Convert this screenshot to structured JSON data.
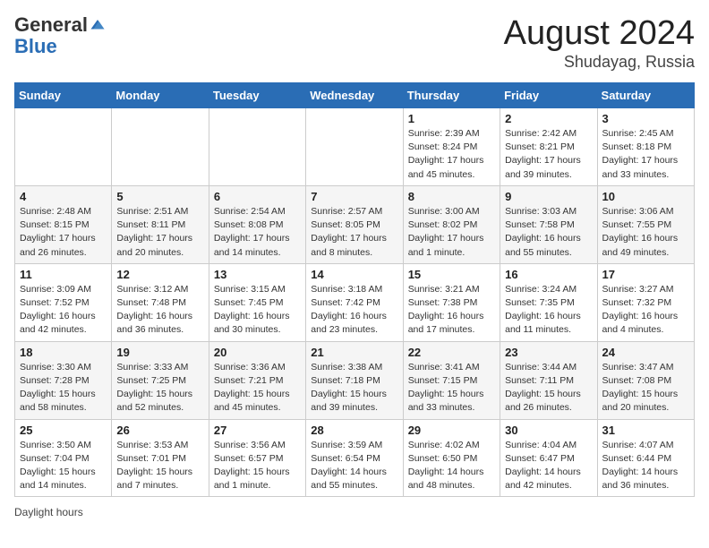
{
  "header": {
    "logo_general": "General",
    "logo_blue": "Blue",
    "title": "August 2024",
    "location": "Shudayag, Russia"
  },
  "weekdays": [
    "Sunday",
    "Monday",
    "Tuesday",
    "Wednesday",
    "Thursday",
    "Friday",
    "Saturday"
  ],
  "weeks": [
    [
      {
        "day": "",
        "info": ""
      },
      {
        "day": "",
        "info": ""
      },
      {
        "day": "",
        "info": ""
      },
      {
        "day": "",
        "info": ""
      },
      {
        "day": "1",
        "info": "Sunrise: 2:39 AM\nSunset: 8:24 PM\nDaylight: 17 hours and 45 minutes."
      },
      {
        "day": "2",
        "info": "Sunrise: 2:42 AM\nSunset: 8:21 PM\nDaylight: 17 hours and 39 minutes."
      },
      {
        "day": "3",
        "info": "Sunrise: 2:45 AM\nSunset: 8:18 PM\nDaylight: 17 hours and 33 minutes."
      }
    ],
    [
      {
        "day": "4",
        "info": "Sunrise: 2:48 AM\nSunset: 8:15 PM\nDaylight: 17 hours and 26 minutes."
      },
      {
        "day": "5",
        "info": "Sunrise: 2:51 AM\nSunset: 8:11 PM\nDaylight: 17 hours and 20 minutes."
      },
      {
        "day": "6",
        "info": "Sunrise: 2:54 AM\nSunset: 8:08 PM\nDaylight: 17 hours and 14 minutes."
      },
      {
        "day": "7",
        "info": "Sunrise: 2:57 AM\nSunset: 8:05 PM\nDaylight: 17 hours and 8 minutes."
      },
      {
        "day": "8",
        "info": "Sunrise: 3:00 AM\nSunset: 8:02 PM\nDaylight: 17 hours and 1 minute."
      },
      {
        "day": "9",
        "info": "Sunrise: 3:03 AM\nSunset: 7:58 PM\nDaylight: 16 hours and 55 minutes."
      },
      {
        "day": "10",
        "info": "Sunrise: 3:06 AM\nSunset: 7:55 PM\nDaylight: 16 hours and 49 minutes."
      }
    ],
    [
      {
        "day": "11",
        "info": "Sunrise: 3:09 AM\nSunset: 7:52 PM\nDaylight: 16 hours and 42 minutes."
      },
      {
        "day": "12",
        "info": "Sunrise: 3:12 AM\nSunset: 7:48 PM\nDaylight: 16 hours and 36 minutes."
      },
      {
        "day": "13",
        "info": "Sunrise: 3:15 AM\nSunset: 7:45 PM\nDaylight: 16 hours and 30 minutes."
      },
      {
        "day": "14",
        "info": "Sunrise: 3:18 AM\nSunset: 7:42 PM\nDaylight: 16 hours and 23 minutes."
      },
      {
        "day": "15",
        "info": "Sunrise: 3:21 AM\nSunset: 7:38 PM\nDaylight: 16 hours and 17 minutes."
      },
      {
        "day": "16",
        "info": "Sunrise: 3:24 AM\nSunset: 7:35 PM\nDaylight: 16 hours and 11 minutes."
      },
      {
        "day": "17",
        "info": "Sunrise: 3:27 AM\nSunset: 7:32 PM\nDaylight: 16 hours and 4 minutes."
      }
    ],
    [
      {
        "day": "18",
        "info": "Sunrise: 3:30 AM\nSunset: 7:28 PM\nDaylight: 15 hours and 58 minutes."
      },
      {
        "day": "19",
        "info": "Sunrise: 3:33 AM\nSunset: 7:25 PM\nDaylight: 15 hours and 52 minutes."
      },
      {
        "day": "20",
        "info": "Sunrise: 3:36 AM\nSunset: 7:21 PM\nDaylight: 15 hours and 45 minutes."
      },
      {
        "day": "21",
        "info": "Sunrise: 3:38 AM\nSunset: 7:18 PM\nDaylight: 15 hours and 39 minutes."
      },
      {
        "day": "22",
        "info": "Sunrise: 3:41 AM\nSunset: 7:15 PM\nDaylight: 15 hours and 33 minutes."
      },
      {
        "day": "23",
        "info": "Sunrise: 3:44 AM\nSunset: 7:11 PM\nDaylight: 15 hours and 26 minutes."
      },
      {
        "day": "24",
        "info": "Sunrise: 3:47 AM\nSunset: 7:08 PM\nDaylight: 15 hours and 20 minutes."
      }
    ],
    [
      {
        "day": "25",
        "info": "Sunrise: 3:50 AM\nSunset: 7:04 PM\nDaylight: 15 hours and 14 minutes."
      },
      {
        "day": "26",
        "info": "Sunrise: 3:53 AM\nSunset: 7:01 PM\nDaylight: 15 hours and 7 minutes."
      },
      {
        "day": "27",
        "info": "Sunrise: 3:56 AM\nSunset: 6:57 PM\nDaylight: 15 hours and 1 minute."
      },
      {
        "day": "28",
        "info": "Sunrise: 3:59 AM\nSunset: 6:54 PM\nDaylight: 14 hours and 55 minutes."
      },
      {
        "day": "29",
        "info": "Sunrise: 4:02 AM\nSunset: 6:50 PM\nDaylight: 14 hours and 48 minutes."
      },
      {
        "day": "30",
        "info": "Sunrise: 4:04 AM\nSunset: 6:47 PM\nDaylight: 14 hours and 42 minutes."
      },
      {
        "day": "31",
        "info": "Sunrise: 4:07 AM\nSunset: 6:44 PM\nDaylight: 14 hours and 36 minutes."
      }
    ]
  ],
  "footer": {
    "daylight_label": "Daylight hours"
  }
}
